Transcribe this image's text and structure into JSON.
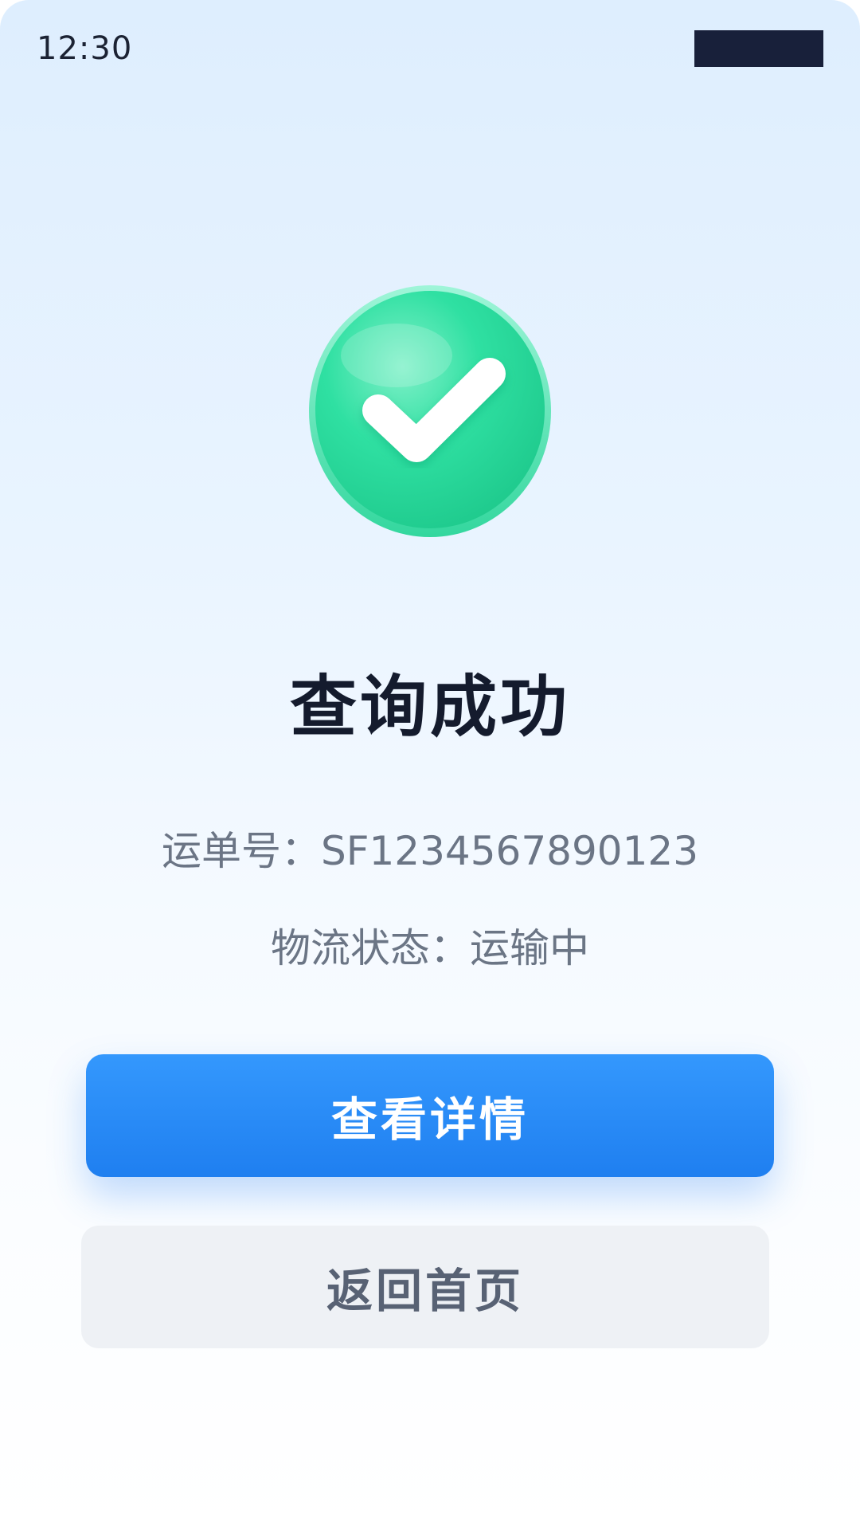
{
  "status_bar": {
    "time": "12:30",
    "block_color": "#18203a"
  },
  "result": {
    "icon": "check-circle-icon",
    "icon_color": "#2bd99b",
    "title": "查询成功",
    "waybill_label": "运单号：SF1234567890123",
    "status_label": "物流状态：运输中"
  },
  "actions": {
    "primary_label": "查看详情",
    "primary_color": "#2a8cf8",
    "secondary_label": "返回首页",
    "secondary_color": "#eef1f5"
  }
}
